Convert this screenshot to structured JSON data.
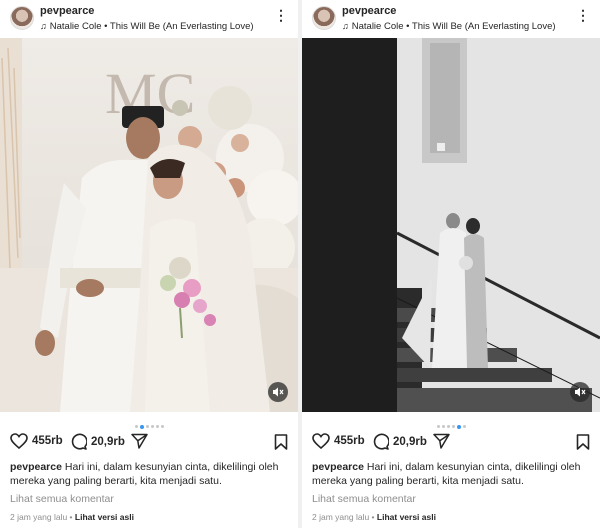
{
  "posts": [
    {
      "username": "pevpearce",
      "music": "Natalie Cole • This Will Be (An Everlasting Love)",
      "likes": "455rb",
      "comments": "20,9rb",
      "caption": "Hari ini, dalam kesunyian cinta, dikelilingi oleh mereka yang paling berarti, kita menjadi satu.",
      "view_comments": "Lihat semua komentar",
      "time": "2 jam yang lalu",
      "separator": "•",
      "translate": "Lihat versi asli",
      "carousel_count": 6,
      "carousel_active": 1,
      "monogram": "MC"
    },
    {
      "username": "pevpearce",
      "music": "Natalie Cole • This Will Be (An Everlasting Love)",
      "likes": "455rb",
      "comments": "20,9rb",
      "caption": "Hari ini, dalam kesunyian cinta, dikelilingi oleh mereka yang paling berarti, kita menjadi satu.",
      "view_comments": "Lihat semua komentar",
      "time": "2 jam yang lalu",
      "separator": "•",
      "translate": "Lihat versi asli",
      "carousel_count": 6,
      "carousel_active": 4
    }
  ],
  "icons": {
    "music": "music-note-icon",
    "more": "more-vertical-icon",
    "like": "heart-icon",
    "comment": "comment-bubble-icon",
    "share": "paper-plane-icon",
    "save": "bookmark-icon",
    "mute": "speaker-muted-icon"
  },
  "colors": {
    "accent": "#3897f0",
    "muted": "#8e8e8e",
    "text": "#262626"
  }
}
